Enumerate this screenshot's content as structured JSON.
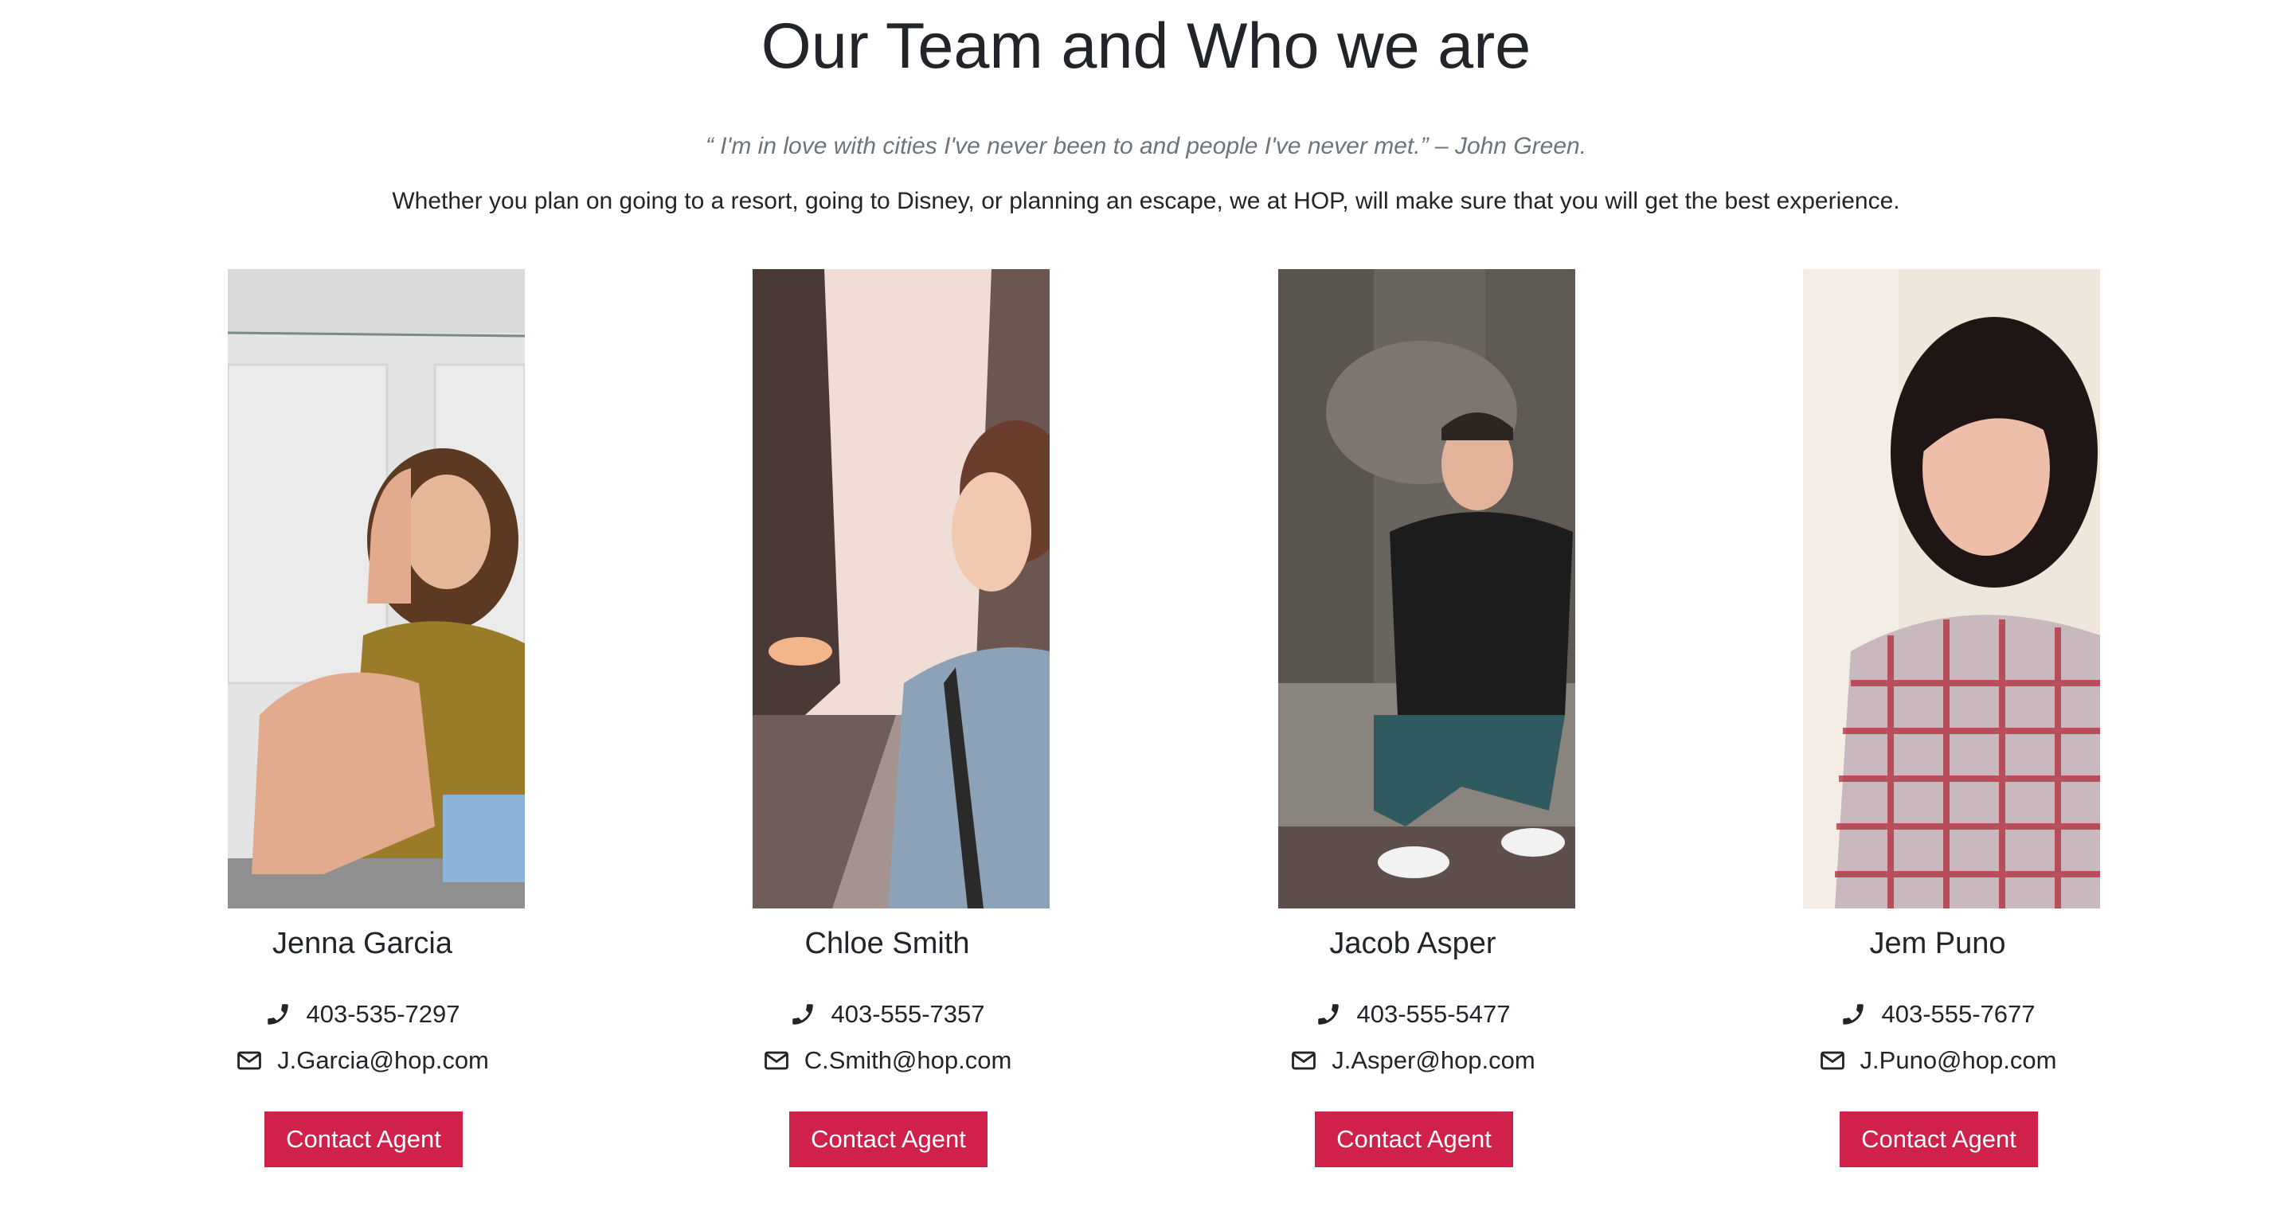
{
  "page": {
    "title": "Our Team and Who we are",
    "quote": "“ I'm in love with cities I've never been to and people I've never met.” – John Green.",
    "intro": "Whether you plan on going to a resort, going to Disney, or planning an escape, we at HOP, will make sure that you will get the best experience."
  },
  "team": [
    {
      "name": "Jenna Garcia",
      "phone": "403-535-7297",
      "email": "J.Garcia@hop.com",
      "button": "Contact Agent"
    },
    {
      "name": "Chloe Smith",
      "phone": "403-555-7357",
      "email": "C.Smith@hop.com",
      "button": "Contact Agent"
    },
    {
      "name": "Jacob Asper",
      "phone": "403-555-5477",
      "email": "J.Asper@hop.com",
      "button": "Contact Agent"
    },
    {
      "name": "Jem Puno",
      "phone": "403-555-7677",
      "email": "J.Puno@hop.com",
      "button": "Contact Agent"
    }
  ],
  "icons": {
    "phone": "phone-icon",
    "email": "envelope-icon"
  },
  "colors": {
    "accent": "#d0214a",
    "text": "#212529",
    "muted": "#6c757d"
  }
}
